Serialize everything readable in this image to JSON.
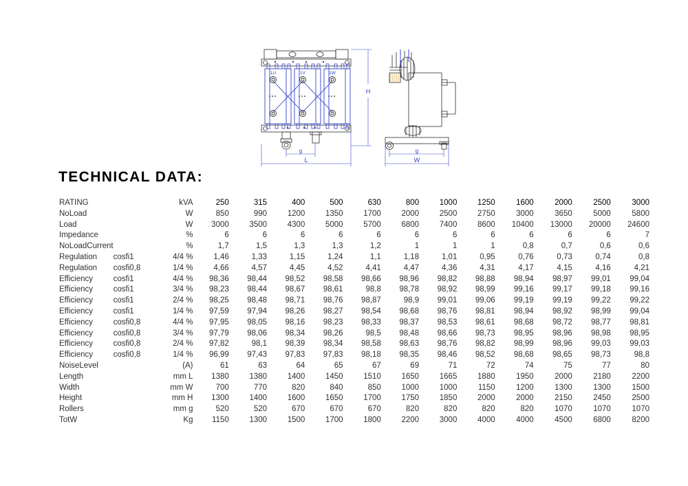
{
  "title": "TECHNICAL DATA:",
  "drawing": {
    "labels": {
      "coil_1u": "1U",
      "coil_1v": "1V",
      "coil_1w": "1W",
      "height": "H",
      "length": "L",
      "rollers_front": "g",
      "rollers_side": "g",
      "width": "W"
    },
    "accent_color": "#3344cc",
    "line_color": "#2b2b2b"
  },
  "table": {
    "columns": [
      "250",
      "315",
      "400",
      "500",
      "630",
      "800",
      "1000",
      "1250",
      "1600",
      "2000",
      "2500",
      "3000"
    ],
    "header": {
      "name": "RATING",
      "sub": "",
      "unit": "kVA"
    },
    "rows": [
      {
        "name": "NoLoad",
        "sub": "",
        "unit": "W",
        "values": [
          "850",
          "990",
          "1200",
          "1350",
          "1700",
          "2000",
          "2500",
          "2750",
          "3000",
          "3650",
          "5000",
          "5800"
        ]
      },
      {
        "name": "Load",
        "sub": "",
        "unit": "W",
        "values": [
          "3000",
          "3500",
          "4300",
          "5000",
          "5700",
          "6800",
          "7400",
          "8600",
          "10400",
          "13000",
          "20000",
          "24600"
        ]
      },
      {
        "name": "Impedance",
        "sub": "",
        "unit": "%",
        "values": [
          "6",
          "6",
          "6",
          "6",
          "6",
          "6",
          "6",
          "6",
          "6",
          "6",
          "6",
          "7"
        ]
      },
      {
        "name": "NoLoadCurrent",
        "sub": "",
        "unit": "%",
        "values": [
          "1,7",
          "1,5",
          "1,3",
          "1,3",
          "1,2",
          "1",
          "1",
          "1",
          "0,8",
          "0,7",
          "0,6",
          "0,6"
        ]
      },
      {
        "name": "Regulation",
        "sub": "cosfi1",
        "unit": "4/4 %",
        "values": [
          "1,46",
          "1,33",
          "1,15",
          "1,24",
          "1,1",
          "1,18",
          "1,01",
          "0,95",
          "0,76",
          "0,73",
          "0,74",
          "0,8"
        ]
      },
      {
        "name": "Regulation",
        "sub": "cosfi0,8",
        "unit": "1/4 %",
        "values": [
          "4,66",
          "4,57",
          "4,45",
          "4,52",
          "4,41",
          "4,47",
          "4,36",
          "4,31",
          "4,17",
          "4,15",
          "4,16",
          "4,21"
        ]
      },
      {
        "name": "Efficiency",
        "sub": "cosfi1",
        "unit": "4/4 %",
        "values": [
          "98,36",
          "98,44",
          "98,52",
          "98,58",
          "98,66",
          "98,96",
          "98,82",
          "98,88",
          "98,94",
          "98,97",
          "99,01",
          "99,04"
        ]
      },
      {
        "name": "Efficiency",
        "sub": "cosfi1",
        "unit": "3/4 %",
        "values": [
          "98,23",
          "98,44",
          "98,67",
          "98,61",
          "98,8",
          "98,78",
          "98,92",
          "98,99",
          "99,16",
          "99,17",
          "99,18",
          "99,16"
        ]
      },
      {
        "name": "Efficiency",
        "sub": "cosfi1",
        "unit": "2/4 %",
        "values": [
          "98,25",
          "98,48",
          "98,71",
          "98,76",
          "98,87",
          "98,9",
          "99,01",
          "99,06",
          "99,19",
          "99,19",
          "99,22",
          "99,22"
        ]
      },
      {
        "name": "Efficiency",
        "sub": "cosfi1",
        "unit": "1/4 %",
        "values": [
          "97,59",
          "97,94",
          "98,26",
          "98,27",
          "98,54",
          "98,68",
          "98,76",
          "98,81",
          "98,94",
          "98,92",
          "98,99",
          "99,04"
        ]
      },
      {
        "name": "Efficiency",
        "sub": "cosfi0,8",
        "unit": "4/4 %",
        "values": [
          "97,95",
          "98,05",
          "98,16",
          "98,23",
          "98,33",
          "98,37",
          "98,53",
          "98,61",
          "98,68",
          "98,72",
          "98,77",
          "98,81"
        ]
      },
      {
        "name": "Efficiency",
        "sub": "cosfi0,8",
        "unit": "3/4 %",
        "values": [
          "97,79",
          "98,06",
          "98,34",
          "98,26",
          "98,5",
          "98,48",
          "98,66",
          "98,73",
          "98,95",
          "98,96",
          "98,98",
          "98,95"
        ]
      },
      {
        "name": "Efficiency",
        "sub": "cosfi0,8",
        "unit": "2/4 %",
        "values": [
          "97,82",
          "98,1",
          "98,39",
          "98,34",
          "98,58",
          "98,63",
          "98,76",
          "98,82",
          "98,99",
          "98,96",
          "99,03",
          "99,03"
        ]
      },
      {
        "name": "Efficiency",
        "sub": "cosfi0,8",
        "unit": "1/4 %",
        "values": [
          "96,99",
          "97,43",
          "97,83",
          "97,83",
          "98,18",
          "98,35",
          "98,46",
          "98,52",
          "98,68",
          "98,65",
          "98,73",
          "98,8"
        ]
      },
      {
        "name": "NoiseLevel",
        "sub": "",
        "unit": "(A)",
        "values": [
          "61",
          "63",
          "64",
          "65",
          "67",
          "69",
          "71",
          "72",
          "74",
          "75",
          "77",
          "80"
        ]
      },
      {
        "name": "Length",
        "sub": "",
        "unit": "mm L",
        "values": [
          "1380",
          "1380",
          "1400",
          "1450",
          "1510",
          "1650",
          "1665",
          "1880",
          "1950",
          "2000",
          "2180",
          "2200"
        ]
      },
      {
        "name": "Width",
        "sub": "",
        "unit": "mm W",
        "values": [
          "700",
          "770",
          "820",
          "840",
          "850",
          "1000",
          "1000",
          "1150",
          "1200",
          "1300",
          "1300",
          "1500"
        ]
      },
      {
        "name": "Height",
        "sub": "",
        "unit": "mm H",
        "values": [
          "1300",
          "1400",
          "1600",
          "1650",
          "1700",
          "1750",
          "1850",
          "2000",
          "2000",
          "2150",
          "2450",
          "2500"
        ]
      },
      {
        "name": "Rollers",
        "sub": "",
        "unit": "mm g",
        "values": [
          "520",
          "520",
          "670",
          "670",
          "670",
          "820",
          "820",
          "820",
          "820",
          "1070",
          "1070",
          "1070"
        ]
      },
      {
        "name": "TotW",
        "sub": "",
        "unit": "Kg",
        "values": [
          "1150",
          "1300",
          "1500",
          "1700",
          "1800",
          "2200",
          "3000",
          "4000",
          "4000",
          "4500",
          "6800",
          "8200"
        ]
      }
    ]
  }
}
